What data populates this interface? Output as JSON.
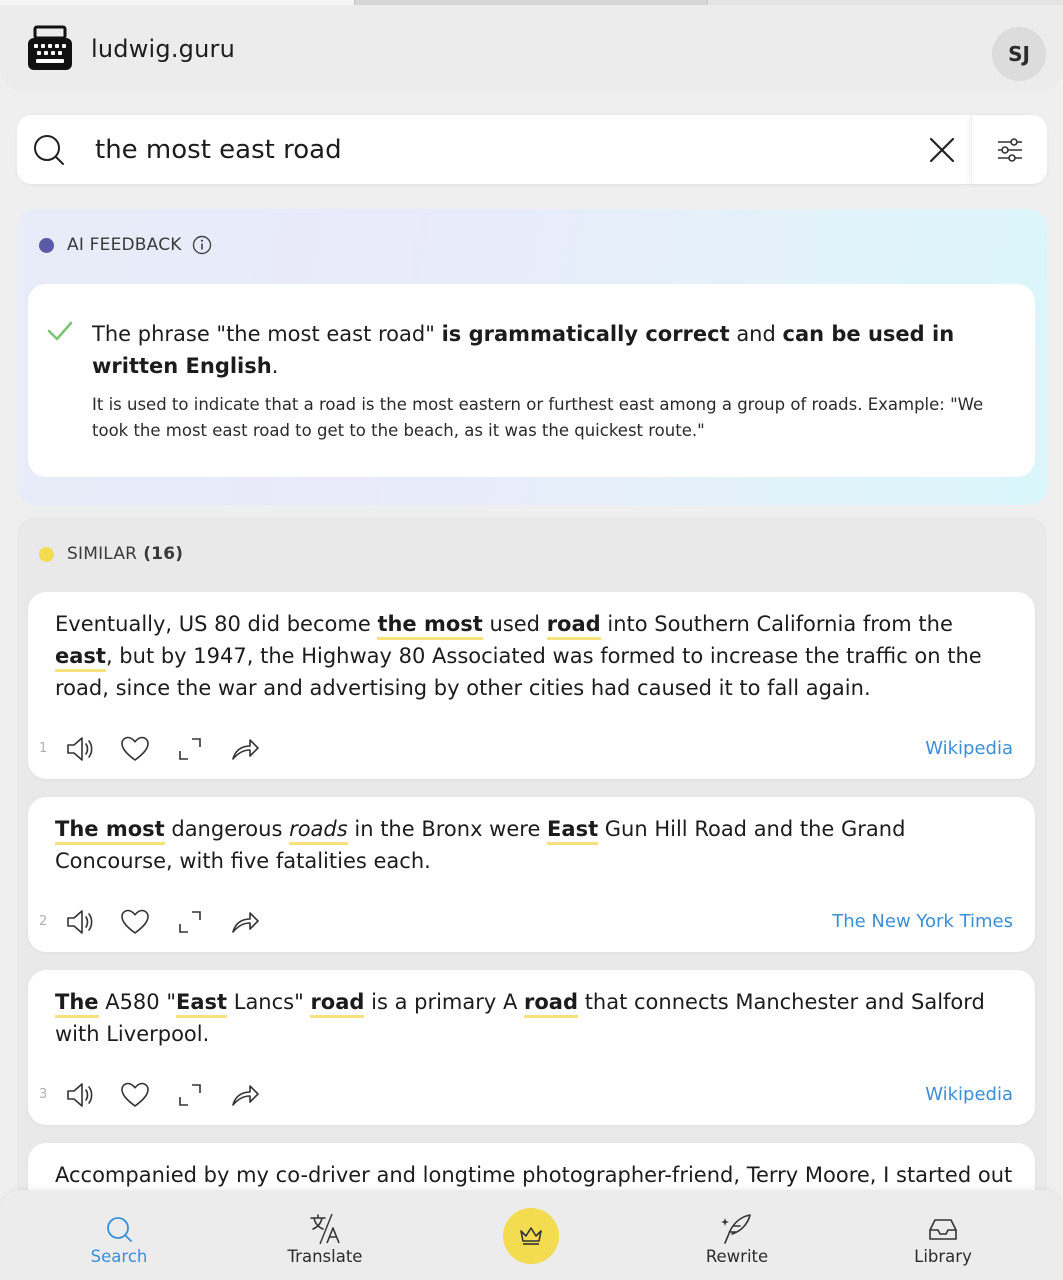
{
  "app": {
    "brand": "ludwig.guru",
    "avatar_initials": "SJ",
    "logo_icon": "typewriter-icon"
  },
  "search": {
    "query": "the most east road",
    "search_icon": "search-icon",
    "clear_icon": "close-icon",
    "filter_icon": "sliders-icon"
  },
  "ai_feedback": {
    "label": "AI FEEDBACK",
    "dot_color": "#5b5aa8",
    "verdict_pre": "The phrase \"the most east road\" ",
    "verdict_bold1": "is grammatically correct",
    "verdict_mid": " and ",
    "verdict_bold2": "can be used in written English",
    "verdict_end": ".",
    "explanation": "It is used to indicate that a road is the most eastern or furthest east among a group of roads. Example: \"We took the most east road to get to the beach, as it was the quickest route.\""
  },
  "similar": {
    "label": "SIMILAR",
    "count": "(16)",
    "dot_color": "#f3dc4f",
    "results": [
      {
        "index": "1",
        "source": "Wikipedia",
        "parts": [
          "Eventually, US 80 did become ",
          "the most",
          " used ",
          "road",
          " into Southern California from the ",
          "east",
          ", but by 1947, the Highway 80 Associated was formed to increase the traffic on the road, since the war and advertising by other cities had caused it to fall again."
        ]
      },
      {
        "index": "2",
        "source": "The New York Times",
        "parts": [
          "The most",
          " dangerous ",
          "roads",
          " in the Bronx were ",
          "East",
          " Gun Hill Road and the Grand Concourse, with five fatalities each."
        ]
      },
      {
        "index": "3",
        "source": "Wikipedia",
        "parts": [
          "The",
          " A580 \"",
          "East",
          " Lancs\" ",
          "road",
          " is a primary A ",
          "road",
          " that connects Manchester and Salford with Liverpool."
        ]
      },
      {
        "text": "Accompanied by my co-driver and longtime photographer-friend, Terry Moore, I started out last"
      }
    ]
  },
  "nav": {
    "search": "Search",
    "translate": "Translate",
    "rewrite": "Rewrite",
    "library": "Library",
    "premium_icon": "crown-icon",
    "active_color": "#3a8fd9"
  }
}
